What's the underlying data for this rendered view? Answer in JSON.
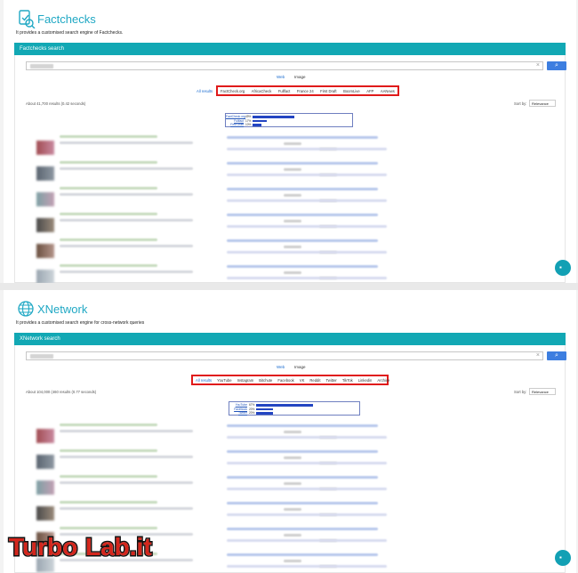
{
  "sections": [
    {
      "title": "Factchecks",
      "subtitle": "It provides a customised search engine of Factchecks.",
      "bar_title": "Factchecks search",
      "search": {
        "clear": "×",
        "button_icon": "search-icon"
      },
      "web_label": "Web",
      "image_label": "Image",
      "all_results": "All results",
      "tabs": [
        "FactCheck.org",
        "AfricaCheck",
        "Fullfact",
        "France 24",
        "First Draft",
        "BoomLive",
        "AFP",
        "AANews"
      ],
      "results_count": "About 41,700 results (0.42 seconds)",
      "sort_label": "Sort by:",
      "sort_value": "Relevance",
      "mini_chart": [
        {
          "label": "FactCheck.org",
          "pct": "49%",
          "value": 49
        },
        {
          "label": "Fullfact",
          "pct": "17%",
          "value": 17
        },
        {
          "label": "First Draft",
          "pct": "10%",
          "value": 10
        }
      ]
    },
    {
      "title": "XNetwork",
      "subtitle": "It provides a customised search engine for cross-network queries",
      "bar_title": "XNetwork search",
      "search": {
        "clear": "×",
        "button_icon": "search-icon"
      },
      "web_label": "Web",
      "image_label": "Image",
      "all_results": "All results",
      "tabs": [
        "YouTube",
        "Instagram",
        "Bitchute",
        "Facebook",
        "VK",
        "Reddit",
        "Twitter",
        "TikTok",
        "Linkedin",
        "Archive"
      ],
      "results_count": "About 104,000 (460 results (0.77 seconds)",
      "sort_label": "Sort by:",
      "sort_value": "Relevance",
      "mini_chart": [
        {
          "label": "YouTube",
          "pct": "67%",
          "value": 67
        },
        {
          "label": "Facebook",
          "pct": "20%",
          "value": 20
        },
        {
          "label": "Twitter",
          "pct": "20%",
          "value": 20
        }
      ]
    }
  ],
  "colors": {
    "accent": "#12a8b4",
    "title": "#20a8c4",
    "highlight": "#e01a1a",
    "link": "#1a6cd0"
  },
  "fab_icon": "chat-icon",
  "watermark": "TurboLab.it"
}
